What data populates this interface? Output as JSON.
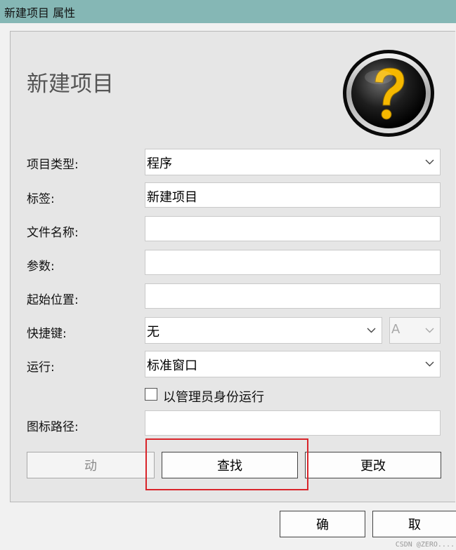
{
  "window": {
    "title": "新建项目 属性"
  },
  "dialog": {
    "heading": "新建项目",
    "fields": {
      "item_type": {
        "label": "项目类型:",
        "value": "程序"
      },
      "tag": {
        "label": "标签:",
        "value": "新建项目"
      },
      "file_name": {
        "label": "文件名称:",
        "value": ""
      },
      "params": {
        "label": "参数:",
        "value": ""
      },
      "start_location": {
        "label": "起始位置:",
        "value": ""
      },
      "hotkey": {
        "label": "快捷键:",
        "value": "无",
        "key_value": "A"
      },
      "run": {
        "label": "运行:",
        "value": "标准窗口"
      },
      "icon_path": {
        "label": "图标路径:",
        "value": ""
      }
    },
    "run_as_admin": {
      "label": "以管理员身份运行",
      "checked": false
    },
    "buttons": {
      "action": "动",
      "find": "查找",
      "change": "更改"
    }
  },
  "footer": {
    "ok": "确",
    "cancel": "取"
  },
  "watermark": "CSDN @ZERO....",
  "colors": {
    "titlebar": "#85b7b5",
    "highlight": "#d9242a",
    "icon_accent": "#f5b800"
  },
  "icons": [
    "help-question-icon",
    "chevron-down-icon"
  ]
}
